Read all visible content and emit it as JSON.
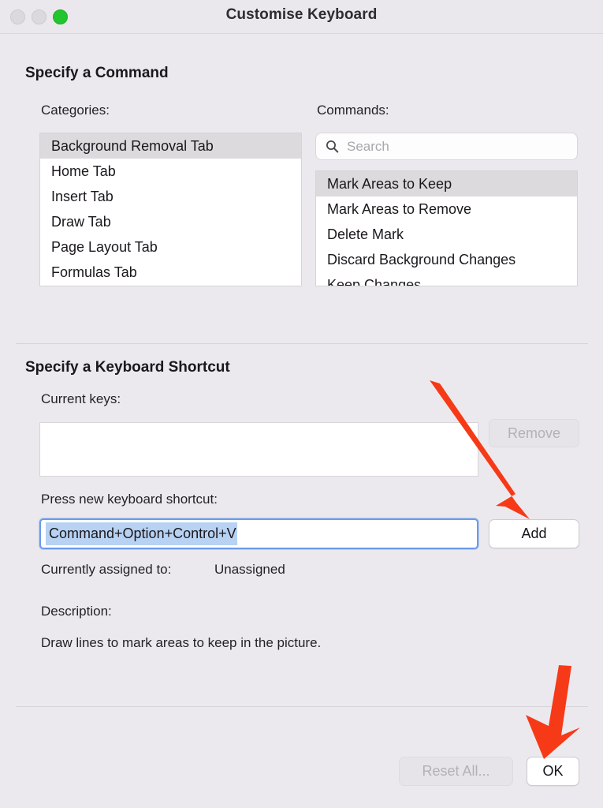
{
  "window": {
    "title": "Customise Keyboard",
    "traffic_lights": [
      {
        "name": "close-button",
        "state": "inactive"
      },
      {
        "name": "minimize-button",
        "state": "inactive"
      },
      {
        "name": "zoom-button",
        "state": "active",
        "color": "#22c52e"
      }
    ]
  },
  "specify_command": {
    "heading": "Specify a Command",
    "categories_label": "Categories:",
    "categories": [
      {
        "label": "Background Removal Tab",
        "selected": true
      },
      {
        "label": "Home Tab",
        "selected": false
      },
      {
        "label": "Insert Tab",
        "selected": false
      },
      {
        "label": "Draw Tab",
        "selected": false
      },
      {
        "label": "Page Layout Tab",
        "selected": false
      },
      {
        "label": "Formulas Tab",
        "selected": false
      }
    ],
    "commands_label": "Commands:",
    "search": {
      "placeholder": "Search",
      "value": "",
      "icon": "search-icon"
    },
    "commands": [
      {
        "label": "Mark Areas to Keep",
        "selected": true
      },
      {
        "label": "Mark Areas to Remove",
        "selected": false
      },
      {
        "label": "Delete Mark",
        "selected": false
      },
      {
        "label": "Discard Background Changes",
        "selected": false
      },
      {
        "label": "Keep Changes",
        "selected": false
      }
    ]
  },
  "specify_shortcut": {
    "heading": "Specify a Keyboard Shortcut",
    "current_keys_label": "Current keys:",
    "current_keys_value": "",
    "remove_button": {
      "label": "Remove",
      "enabled": false
    },
    "press_new_label": "Press new keyboard shortcut:",
    "shortcut_value": "Command+Option+Control+V",
    "shortcut_selected": true,
    "add_button": {
      "label": "Add",
      "enabled": true
    },
    "assigned_label": "Currently assigned to:",
    "assigned_value": "Unassigned",
    "description_label": "Description:",
    "description_text": "Draw lines to mark areas to keep in the picture."
  },
  "footer": {
    "reset_button": {
      "label": "Reset All...",
      "enabled": false
    },
    "ok_button": {
      "label": "OK",
      "enabled": true
    }
  },
  "annotations": {
    "color": "#f63a17",
    "arrows": [
      {
        "name": "arrow-to-add-button",
        "from": [
          545,
          482
        ],
        "to": [
          672,
          658
        ]
      },
      {
        "name": "arrow-to-ok-button",
        "from": [
          722,
          845
        ],
        "to": [
          690,
          962
        ]
      }
    ]
  }
}
